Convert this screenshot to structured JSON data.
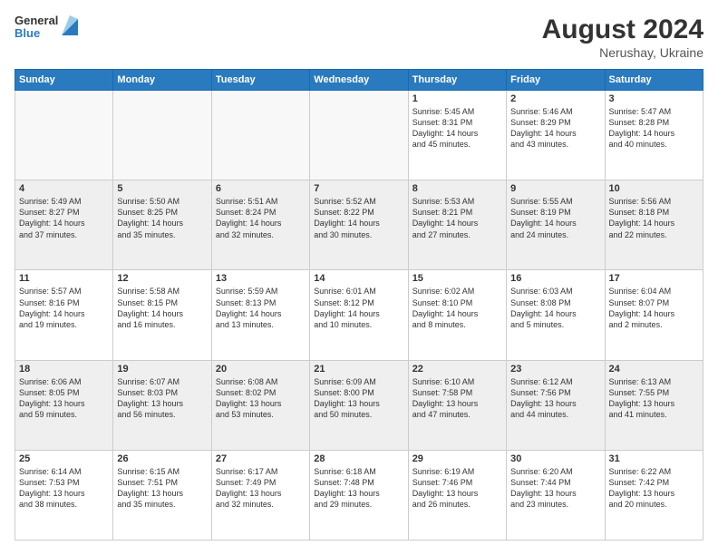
{
  "header": {
    "logo_line1": "General",
    "logo_line2": "Blue",
    "month_year": "August 2024",
    "location": "Nerushay, Ukraine"
  },
  "weekdays": [
    "Sunday",
    "Monday",
    "Tuesday",
    "Wednesday",
    "Thursday",
    "Friday",
    "Saturday"
  ],
  "weeks": [
    [
      {
        "day": "",
        "info": ""
      },
      {
        "day": "",
        "info": ""
      },
      {
        "day": "",
        "info": ""
      },
      {
        "day": "",
        "info": ""
      },
      {
        "day": "1",
        "info": "Sunrise: 5:45 AM\nSunset: 8:31 PM\nDaylight: 14 hours\nand 45 minutes."
      },
      {
        "day": "2",
        "info": "Sunrise: 5:46 AM\nSunset: 8:29 PM\nDaylight: 14 hours\nand 43 minutes."
      },
      {
        "day": "3",
        "info": "Sunrise: 5:47 AM\nSunset: 8:28 PM\nDaylight: 14 hours\nand 40 minutes."
      }
    ],
    [
      {
        "day": "4",
        "info": "Sunrise: 5:49 AM\nSunset: 8:27 PM\nDaylight: 14 hours\nand 37 minutes."
      },
      {
        "day": "5",
        "info": "Sunrise: 5:50 AM\nSunset: 8:25 PM\nDaylight: 14 hours\nand 35 minutes."
      },
      {
        "day": "6",
        "info": "Sunrise: 5:51 AM\nSunset: 8:24 PM\nDaylight: 14 hours\nand 32 minutes."
      },
      {
        "day": "7",
        "info": "Sunrise: 5:52 AM\nSunset: 8:22 PM\nDaylight: 14 hours\nand 30 minutes."
      },
      {
        "day": "8",
        "info": "Sunrise: 5:53 AM\nSunset: 8:21 PM\nDaylight: 14 hours\nand 27 minutes."
      },
      {
        "day": "9",
        "info": "Sunrise: 5:55 AM\nSunset: 8:19 PM\nDaylight: 14 hours\nand 24 minutes."
      },
      {
        "day": "10",
        "info": "Sunrise: 5:56 AM\nSunset: 8:18 PM\nDaylight: 14 hours\nand 22 minutes."
      }
    ],
    [
      {
        "day": "11",
        "info": "Sunrise: 5:57 AM\nSunset: 8:16 PM\nDaylight: 14 hours\nand 19 minutes."
      },
      {
        "day": "12",
        "info": "Sunrise: 5:58 AM\nSunset: 8:15 PM\nDaylight: 14 hours\nand 16 minutes."
      },
      {
        "day": "13",
        "info": "Sunrise: 5:59 AM\nSunset: 8:13 PM\nDaylight: 14 hours\nand 13 minutes."
      },
      {
        "day": "14",
        "info": "Sunrise: 6:01 AM\nSunset: 8:12 PM\nDaylight: 14 hours\nand 10 minutes."
      },
      {
        "day": "15",
        "info": "Sunrise: 6:02 AM\nSunset: 8:10 PM\nDaylight: 14 hours\nand 8 minutes."
      },
      {
        "day": "16",
        "info": "Sunrise: 6:03 AM\nSunset: 8:08 PM\nDaylight: 14 hours\nand 5 minutes."
      },
      {
        "day": "17",
        "info": "Sunrise: 6:04 AM\nSunset: 8:07 PM\nDaylight: 14 hours\nand 2 minutes."
      }
    ],
    [
      {
        "day": "18",
        "info": "Sunrise: 6:06 AM\nSunset: 8:05 PM\nDaylight: 13 hours\nand 59 minutes."
      },
      {
        "day": "19",
        "info": "Sunrise: 6:07 AM\nSunset: 8:03 PM\nDaylight: 13 hours\nand 56 minutes."
      },
      {
        "day": "20",
        "info": "Sunrise: 6:08 AM\nSunset: 8:02 PM\nDaylight: 13 hours\nand 53 minutes."
      },
      {
        "day": "21",
        "info": "Sunrise: 6:09 AM\nSunset: 8:00 PM\nDaylight: 13 hours\nand 50 minutes."
      },
      {
        "day": "22",
        "info": "Sunrise: 6:10 AM\nSunset: 7:58 PM\nDaylight: 13 hours\nand 47 minutes."
      },
      {
        "day": "23",
        "info": "Sunrise: 6:12 AM\nSunset: 7:56 PM\nDaylight: 13 hours\nand 44 minutes."
      },
      {
        "day": "24",
        "info": "Sunrise: 6:13 AM\nSunset: 7:55 PM\nDaylight: 13 hours\nand 41 minutes."
      }
    ],
    [
      {
        "day": "25",
        "info": "Sunrise: 6:14 AM\nSunset: 7:53 PM\nDaylight: 13 hours\nand 38 minutes."
      },
      {
        "day": "26",
        "info": "Sunrise: 6:15 AM\nSunset: 7:51 PM\nDaylight: 13 hours\nand 35 minutes."
      },
      {
        "day": "27",
        "info": "Sunrise: 6:17 AM\nSunset: 7:49 PM\nDaylight: 13 hours\nand 32 minutes."
      },
      {
        "day": "28",
        "info": "Sunrise: 6:18 AM\nSunset: 7:48 PM\nDaylight: 13 hours\nand 29 minutes."
      },
      {
        "day": "29",
        "info": "Sunrise: 6:19 AM\nSunset: 7:46 PM\nDaylight: 13 hours\nand 26 minutes."
      },
      {
        "day": "30",
        "info": "Sunrise: 6:20 AM\nSunset: 7:44 PM\nDaylight: 13 hours\nand 23 minutes."
      },
      {
        "day": "31",
        "info": "Sunrise: 6:22 AM\nSunset: 7:42 PM\nDaylight: 13 hours\nand 20 minutes."
      }
    ]
  ]
}
